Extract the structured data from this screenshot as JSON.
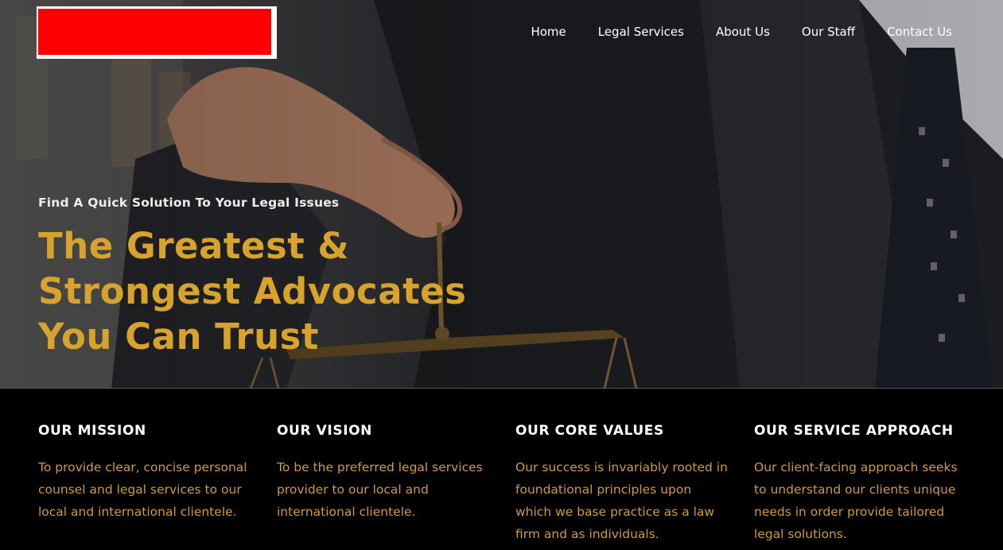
{
  "header": {
    "logo": "logo placeholder",
    "nav": [
      "Home",
      "Legal Services",
      "About Us",
      "Our Staff",
      "Contact Us"
    ]
  },
  "hero": {
    "tagline": "Find A Quick Solution To Your Legal Issues",
    "headline": "The Greatest & Strongest Advocates You Can Trust"
  },
  "values": [
    {
      "title": "OUR MISSION",
      "text": "To provide clear, concise personal counsel and legal services to our local and international clientele."
    },
    {
      "title": "OUR VISION",
      "text": "To be the preferred legal services provider to our local and international clientele."
    },
    {
      "title": "OUR CORE VALUES",
      "text": "Our success is invariably rooted in foundational principles upon which we base practice as a law firm and as individuals."
    },
    {
      "title": "OUR SERVICE APPROACH",
      "text": "Our client-facing approach seeks to understand our clients unique needs in order provide tailored legal solutions."
    }
  ],
  "colors": {
    "accent": "#d8a32c",
    "body_accent": "#d29b34",
    "logo": "#ff0000",
    "footer_bg": "#000000"
  }
}
